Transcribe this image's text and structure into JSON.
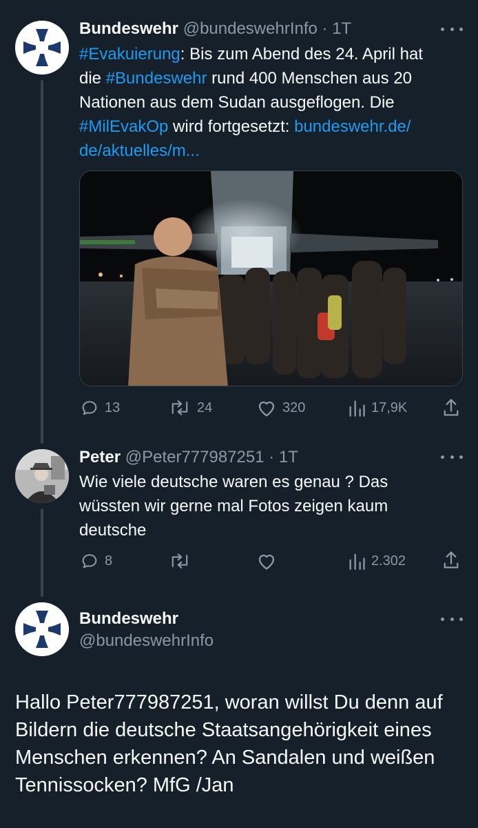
{
  "tweet1": {
    "display_name": "Bundeswehr",
    "handle": "@bundeswehrInfo",
    "separator": "·",
    "time": "1T",
    "text_lines": [
      [
        {
          "t": "#Evakuierung",
          "link": true
        },
        {
          "t": ": Bis zum Abend des 24. April hat",
          "link": false
        }
      ],
      [
        {
          "t": "die ",
          "link": false
        },
        {
          "t": "#Bundeswehr",
          "link": true
        },
        {
          "t": " rund 400 Menschen aus 20",
          "link": false
        }
      ],
      [
        {
          "t": "Nationen aus dem Sudan ausgeflogen. Die",
          "link": false
        }
      ],
      [
        {
          "t": "#MilEvakOp",
          "link": true
        },
        {
          "t": " wird fortgesetzt: ",
          "link": false
        },
        {
          "t": "bundeswehr.de/",
          "link": true
        }
      ],
      [
        {
          "t": "de/aktuelles/m...",
          "link": true
        }
      ]
    ],
    "actions": {
      "replies": "13",
      "retweets": "24",
      "likes": "320",
      "views": "17,9K"
    }
  },
  "tweet2": {
    "display_name": "Peter",
    "handle": "@Peter777987251",
    "separator": "·",
    "time": "1T",
    "text_lines": [
      "Wie viele deutsche waren es genau ? Das",
      "wüssten wir gerne mal Fotos zeigen kaum",
      "deutsche"
    ],
    "actions": {
      "replies": "8",
      "retweets": "",
      "likes": "",
      "views": "2.302"
    }
  },
  "tweet3": {
    "display_name": "Bundeswehr",
    "handle": "@bundeswehrInfo",
    "text_lines": [
      "Hallo Peter777987251, woran willst Du denn auf",
      "Bildern die deutsche Staatsangehörigkeit eines",
      "Menschen erkennen? An Sandalen und weißen",
      "Tennissocken? MfG /Jan"
    ]
  },
  "colors": {
    "background": "#15202b",
    "text": "#f7f9f9",
    "secondary": "#8b98a5",
    "link": "#1d9bf0",
    "thread_line": "#38444d",
    "logo_blue": "#1b3a6b"
  },
  "icons": {
    "reply": "reply-icon",
    "retweet": "retweet-icon",
    "like": "heart-icon",
    "views": "views-icon",
    "share": "share-icon",
    "more": "more-icon"
  }
}
